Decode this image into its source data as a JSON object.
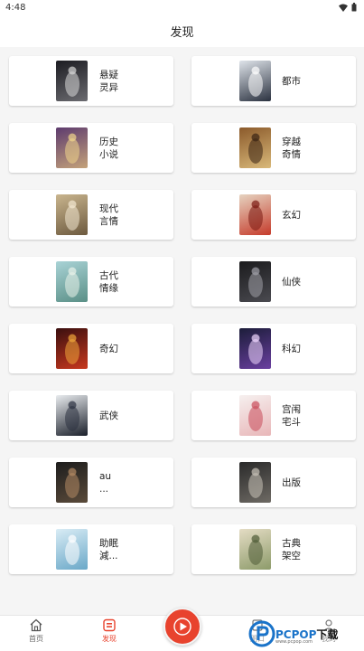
{
  "status_bar": {
    "time": "4:48"
  },
  "header": {
    "title": "发现"
  },
  "categories": [
    {
      "label": "悬疑\n灵异",
      "cover_colors": [
        "#1c1c22",
        "#6b6b70"
      ],
      "cover_accent": "#d9d9d9"
    },
    {
      "label": "都市",
      "cover_colors": [
        "#dfe4ea",
        "#2b3240"
      ],
      "cover_accent": "#ffffff"
    },
    {
      "label": "历史\n小说",
      "cover_colors": [
        "#5d3b6e",
        "#c4a27a"
      ],
      "cover_accent": "#f1d58b"
    },
    {
      "label": "穿越\n奇情",
      "cover_colors": [
        "#8b5a2b",
        "#d9b97a"
      ],
      "cover_accent": "#3a2414"
    },
    {
      "label": "现代\n言情",
      "cover_colors": [
        "#c9b58e",
        "#6d5a3f"
      ],
      "cover_accent": "#f3e8d2"
    },
    {
      "label": "玄幻",
      "cover_colors": [
        "#e6d3c0",
        "#c53b2b"
      ],
      "cover_accent": "#7a1a12"
    },
    {
      "label": "古代\n情缘",
      "cover_colors": [
        "#a9d3d6",
        "#5a8f86"
      ],
      "cover_accent": "#e9f2ea"
    },
    {
      "label": "仙侠",
      "cover_colors": [
        "#1b1b1d",
        "#4a4a50"
      ],
      "cover_accent": "#a0a0a8"
    },
    {
      "label": "奇幻",
      "cover_colors": [
        "#3a0f0f",
        "#c8381e"
      ],
      "cover_accent": "#f0a63b"
    },
    {
      "label": "科幻",
      "cover_colors": [
        "#1c1d3a",
        "#6a3fa0"
      ],
      "cover_accent": "#f0d7ff"
    },
    {
      "label": "武侠",
      "cover_colors": [
        "#e9ecef",
        "#1a1f2a"
      ],
      "cover_accent": "#2b3140"
    },
    {
      "label": "宫闱\n宅斗",
      "cover_colors": [
        "#f6f0ef",
        "#e8b6b8"
      ],
      "cover_accent": "#c94b5a"
    },
    {
      "label": "au\n...",
      "cover_colors": [
        "#1d1d1d",
        "#5a4a3a"
      ],
      "cover_accent": "#b48a64"
    },
    {
      "label": "出版",
      "cover_colors": [
        "#2a2a2a",
        "#6e6a64"
      ],
      "cover_accent": "#c8c2b8"
    },
    {
      "label": "助眠\n減...",
      "cover_colors": [
        "#d9ecf5",
        "#6aa8c8"
      ],
      "cover_accent": "#ffffff"
    },
    {
      "label": "古典\n架空",
      "cover_colors": [
        "#e4dcc4",
        "#8d9b6a"
      ],
      "cover_accent": "#4e5b36"
    }
  ],
  "bottom_nav": {
    "home_label": "首页",
    "discover_label": "发现",
    "partial_label_3": "朋口",
    "partial_label_4": "我的"
  },
  "watermark": {
    "brand": "PCPOP",
    "suffix": "下载",
    "sub": "www.pcpop.com"
  },
  "colors": {
    "accent": "#e8432e",
    "nav_active": "#e8432e",
    "watermark_blue": "#1a73c9"
  }
}
